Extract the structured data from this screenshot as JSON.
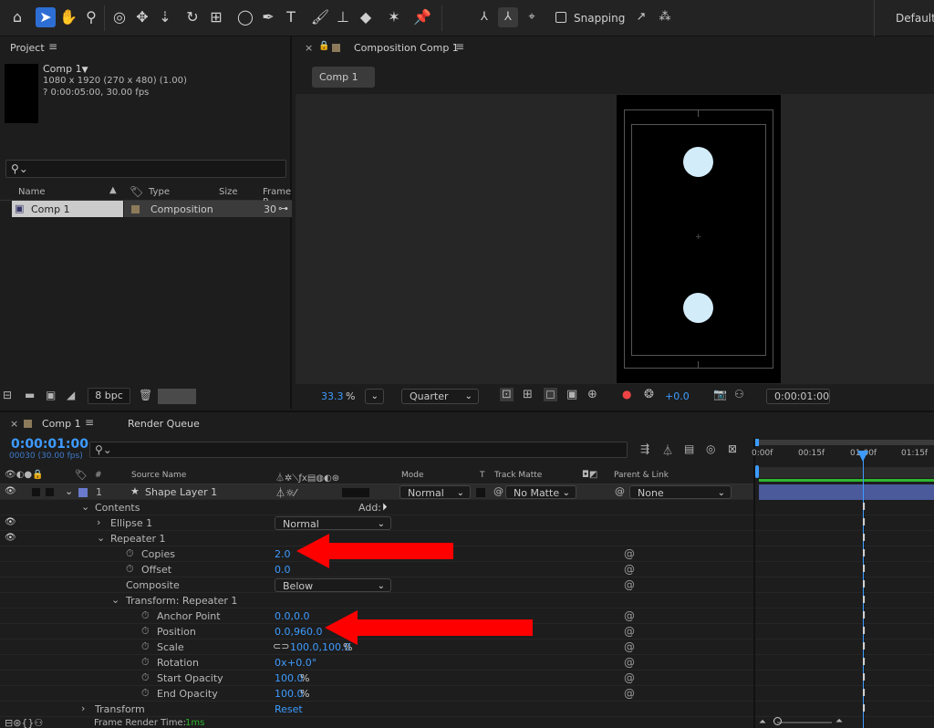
{
  "toolbar": {
    "snapping_label": "Snapping",
    "workspace_label": "Default"
  },
  "project_panel": {
    "title": "Project",
    "comp_name": "Comp 1",
    "comp_size": "1080 x 1920  (270 x 480) (1.00)",
    "comp_duration": "? 0:00:05:00, 30.00 fps",
    "search_placeholder": "",
    "columns": {
      "name": "Name",
      "type": "Type",
      "size": "Size",
      "frame_rate": "Frame R"
    },
    "item": {
      "name": "Comp 1",
      "type": "Composition",
      "frame_rate": "30"
    },
    "bpc": "8 bpc"
  },
  "comp_panel": {
    "tab_title": "Composition Comp 1",
    "flow_tab": "Comp 1",
    "zoom_value": "33.3",
    "zoom_unit": "%",
    "resolution": "Quarter",
    "exposure": "+0.0",
    "timecode": "0:00:01:00"
  },
  "timeline": {
    "tab_comp": "Comp 1",
    "tab_render": "Render Queue",
    "current_time": "0:00:01:00",
    "frame_info": "00030 (30.00 fps)",
    "columns": {
      "num": "#",
      "source_name": "Source Name",
      "mode": "Mode",
      "t": "T",
      "track_matte": "Track Matte",
      "parent": "Parent & Link"
    },
    "ruler": [
      "0:00f",
      "00:15f",
      "01:00f",
      "01:15f"
    ],
    "layer": {
      "num": "1",
      "name": "Shape Layer 1",
      "mode": "Normal",
      "matte": "No Matte",
      "parent": "None"
    },
    "contents_label": "Contents",
    "add_label": "Add:",
    "ellipse_label": "Ellipse 1",
    "ellipse_mode": "Normal",
    "repeater_label": "Repeater 1",
    "copies_label": "Copies",
    "copies_value": "2.0",
    "offset_label": "Offset",
    "offset_value": "0.0",
    "composite_label": "Composite",
    "composite_value": "Below",
    "transform_repeater_label": "Transform: Repeater 1",
    "anchor_label": "Anchor Point",
    "anchor_value": "0.0,0.0",
    "position_label": "Position",
    "position_value": "0.0,960.0",
    "scale_label": "Scale",
    "scale_value": "100.0,100.0",
    "scale_unit": "%",
    "rotation_label": "Rotation",
    "rotation_value_a": "0x",
    "rotation_value_b": "+0.0°",
    "start_opacity_label": "Start Opacity",
    "start_opacity_value": "100.0",
    "end_opacity_label": "End Opacity",
    "end_opacity_value": "100.0",
    "pct": "%",
    "transform_label": "Transform",
    "reset_label": "Reset"
  },
  "status_bar": {
    "render_time_label": "Frame Render Time:",
    "render_time_value": "1ms"
  },
  "colors": {
    "accent_blue": "#3d9bff",
    "annotation_red": "#ff0000",
    "layer_bar": "#4a5a9a",
    "work_area_green": "#2fb52f"
  }
}
